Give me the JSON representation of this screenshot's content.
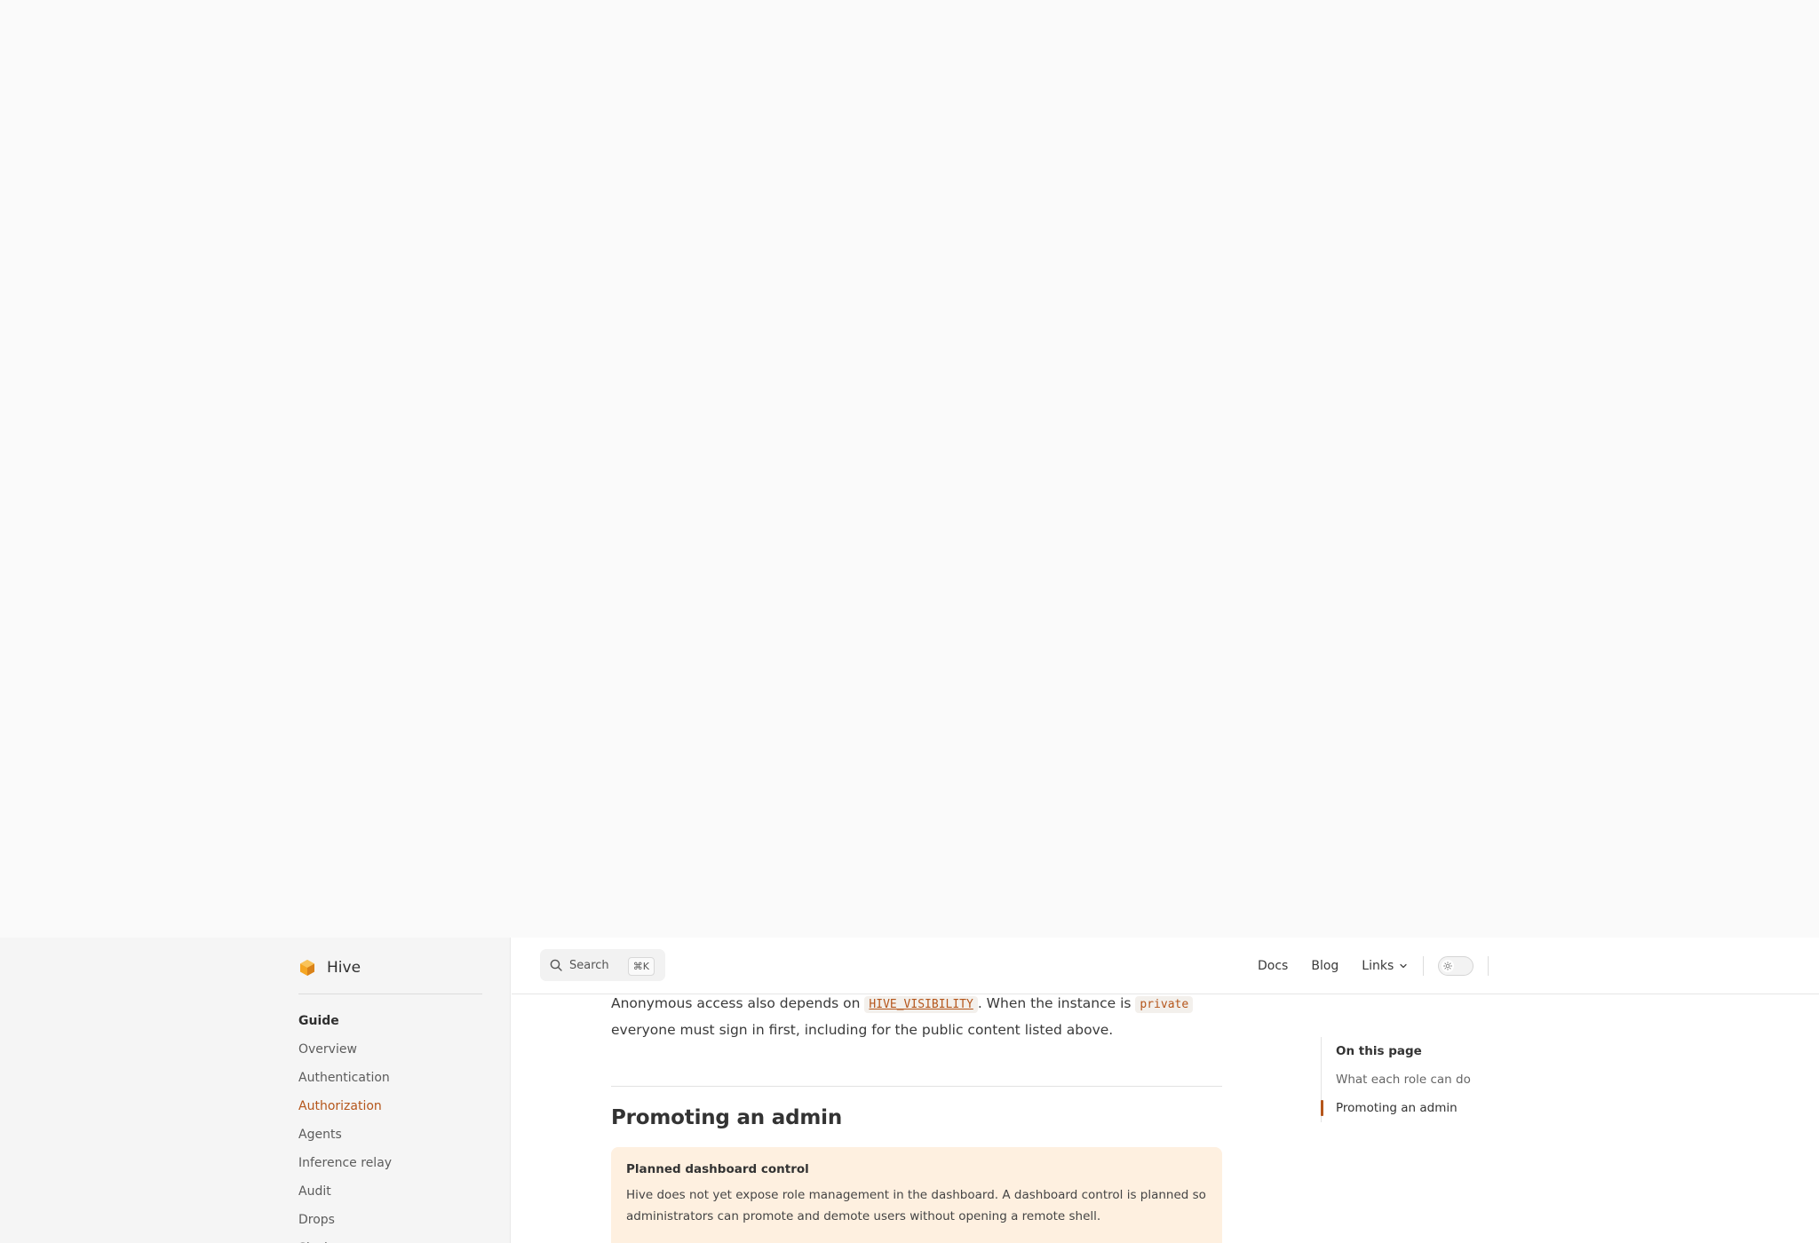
{
  "brand": {
    "name": "Hive"
  },
  "sidebar": {
    "heading": "Guide",
    "items": [
      {
        "label": "Overview"
      },
      {
        "label": "Authentication"
      },
      {
        "label": "Authorization",
        "active": true
      },
      {
        "label": "Agents"
      },
      {
        "label": "Inference relay"
      },
      {
        "label": "Audit"
      },
      {
        "label": "Drops"
      },
      {
        "label": "Slack"
      }
    ]
  },
  "topbar": {
    "search": {
      "label": "Search",
      "shortcut": "⌘K"
    },
    "links": {
      "docs": "Docs",
      "blog": "Blog",
      "links": "Links"
    },
    "theme_toggle": {
      "icon": "sun-icon"
    }
  },
  "content": {
    "para1_a": "Anonymous access also depends on ",
    "para1_code1": "HIVE_VISIBILITY",
    "para1_b": ". When the instance is ",
    "para1_code2": "private",
    "para1_c": " everyone must sign in first, including for the public content listed above.",
    "heading": "Promoting an admin",
    "callout": {
      "title": "Planned dashboard control",
      "body": "Hive does not yet expose role management in the dashboard. A dashboard control is planned so administrators can promote and demote users without opening a remote shell."
    }
  },
  "toc": {
    "heading": "On this page",
    "items": [
      {
        "label": "What each role can do"
      },
      {
        "label": "Promoting an admin",
        "active": true
      }
    ]
  },
  "colors": {
    "accent": "#b5561b",
    "callout_bg": "#fef0e0",
    "sidebar_bg": "#f5f5f5"
  }
}
